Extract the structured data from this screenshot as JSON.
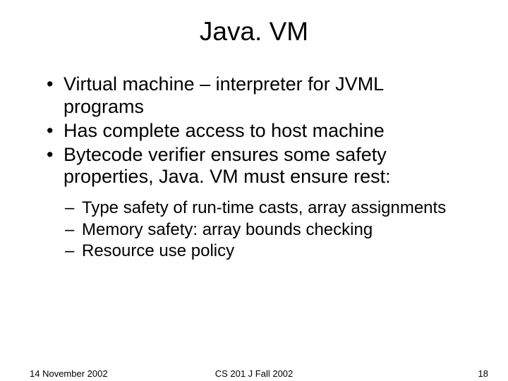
{
  "title": "Java. VM",
  "bullets": [
    "Virtual machine – interpreter for JVML programs",
    "Has complete access to host machine",
    "Bytecode verifier ensures some safety properties, Java. VM must ensure rest:"
  ],
  "subbullets": [
    "Type safety of run-time casts, array assignments",
    "Memory safety: array bounds checking",
    "Resource use policy"
  ],
  "footer": {
    "date": "14 November 2002",
    "course": "CS 201 J Fall 2002",
    "page": "18"
  }
}
